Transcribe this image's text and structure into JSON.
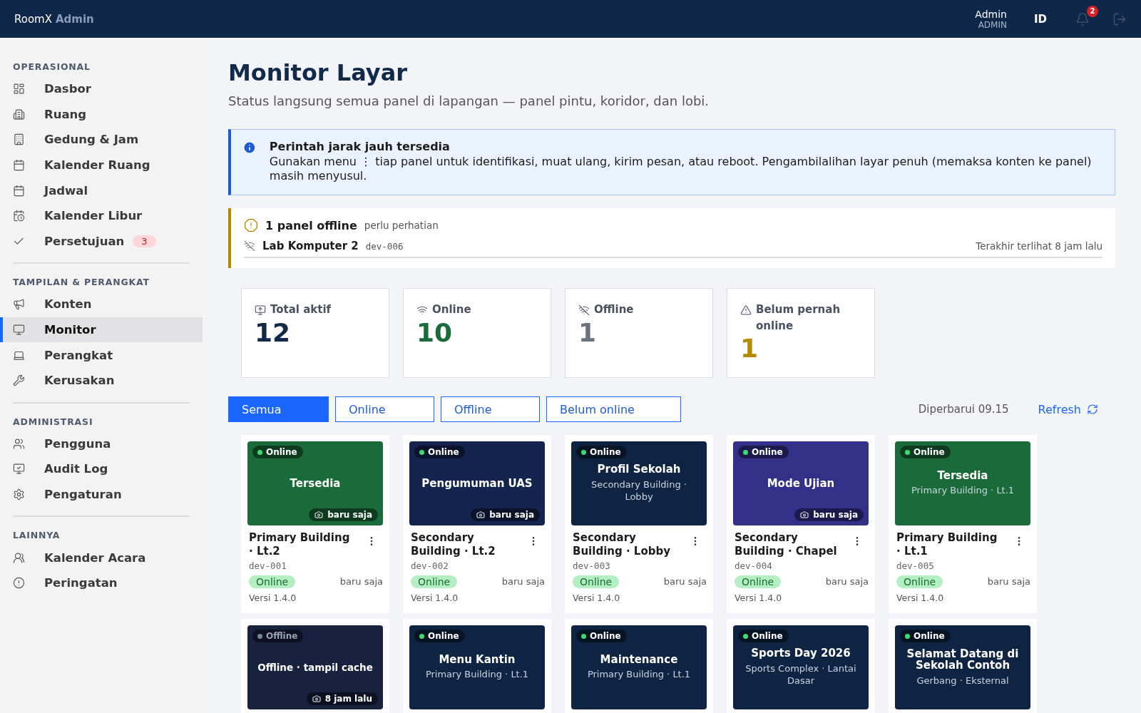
{
  "topbar": {
    "brand": "RoomX",
    "brand_suffix": "Admin",
    "user": {
      "name": "Admin",
      "role": "ADMIN"
    },
    "language": "ID",
    "notifications": "2"
  },
  "sidebar": {
    "sections": [
      {
        "heading": "OPERASIONAL",
        "items": [
          {
            "label": "Dasbor",
            "selected": false
          },
          {
            "label": "Ruang",
            "selected": false
          },
          {
            "label": "Gedung & Jam",
            "selected": false
          },
          {
            "label": "Kalender Ruang",
            "selected": false
          },
          {
            "label": "Jadwal",
            "selected": false
          },
          {
            "label": "Kalender Libur",
            "selected": false
          },
          {
            "label": "Persetujuan",
            "selected": false,
            "badge": "3"
          }
        ]
      },
      {
        "heading": "TAMPILAN & PERANGKAT",
        "items": [
          {
            "label": "Konten",
            "selected": false
          },
          {
            "label": "Monitor",
            "selected": true
          },
          {
            "label": "Perangkat",
            "selected": false
          },
          {
            "label": "Kerusakan",
            "selected": false
          }
        ]
      },
      {
        "heading": "ADMINISTRASI",
        "items": [
          {
            "label": "Pengguna",
            "selected": false
          },
          {
            "label": "Audit Log",
            "selected": false
          },
          {
            "label": "Pengaturan",
            "selected": false
          }
        ]
      },
      {
        "heading": "LAINNYA",
        "items": [
          {
            "label": "Kalender Acara",
            "selected": false
          },
          {
            "label": "Peringatan",
            "selected": false
          }
        ]
      }
    ]
  },
  "page": {
    "title": "Monitor Layar",
    "subtitle": "Status langsung semua panel di lapangan — panel pintu, koridor, dan lobi."
  },
  "info_alert": {
    "title": "Perintah jarak jauh tersedia",
    "text": "Gunakan menu ⋮ tiap panel untuk identifikasi, muat ulang, kirim pesan, atau reboot. Pengambilalihan layar penuh (memaksa konten ke panel) masih menyusul."
  },
  "offline_alert": {
    "title": "1 panel offline",
    "note": "perlu perhatian",
    "panels": [
      {
        "name": "Lab Komputer 2",
        "device": "dev-006",
        "last_seen": "Terakhir terlihat 8 jam lalu"
      }
    ]
  },
  "stats": [
    {
      "label": "Total aktif",
      "value": "12",
      "color": "#112a4a"
    },
    {
      "label": "Online",
      "value": "10",
      "color": "#1b6b3a"
    },
    {
      "label": "Offline",
      "value": "1",
      "color": "#6b7280"
    },
    {
      "label": "Belum pernah online",
      "value": "1",
      "color": "#b58a00"
    }
  ],
  "filters": [
    {
      "label": "Semua",
      "selected": true
    },
    {
      "label": "Online",
      "selected": false
    },
    {
      "label": "Offline",
      "selected": false
    },
    {
      "label": "Belum online",
      "selected": false
    }
  ],
  "updated": "Diperbarui 09.15",
  "refresh": "Refresh",
  "panels": [
    {
      "online": true,
      "badge": "Online",
      "color": "#1b6b3a",
      "title": "Tersedia",
      "snapshot": "baru saja",
      "name": "Primary Building · Lt.2",
      "device": "dev-001",
      "status": "Online",
      "seen": "baru saja",
      "version": "Versi 1.4.0"
    },
    {
      "online": true,
      "badge": "Online",
      "color": "#14244f",
      "title": "Pengumuman UAS",
      "snapshot": "baru saja",
      "name": "Secondary Building · Lt.2",
      "device": "dev-002",
      "status": "Online",
      "seen": "baru saja",
      "version": "Versi 1.4.0"
    },
    {
      "online": true,
      "badge": "Online",
      "color": "#0f2442",
      "title": "Profil Sekolah",
      "subtitle": "Secondary Building · Lobby",
      "name": "Secondary Building · Lobby",
      "device": "dev-003",
      "status": "Online",
      "seen": "baru saja",
      "version": "Versi 1.4.0"
    },
    {
      "online": true,
      "badge": "Online",
      "color": "#33308a",
      "title": "Mode Ujian",
      "snapshot": "baru saja",
      "name": "Secondary Building · Chapel",
      "device": "dev-004",
      "status": "Online",
      "seen": "baru saja",
      "version": "Versi 1.4.0"
    },
    {
      "online": true,
      "badge": "Online",
      "color": "#1b6b3a",
      "title": "Tersedia",
      "subtitle": "Primary Building · Lt.1",
      "name": "Primary Building · Lt.1",
      "device": "dev-005",
      "status": "Online",
      "seen": "baru saja",
      "version": "Versi 1.4.0"
    },
    {
      "online": false,
      "badge": "Offline",
      "color": "#17223f",
      "overlay": "Offline · tampil cache",
      "snapshot": "8 jam lalu"
    },
    {
      "online": true,
      "badge": "Online",
      "color": "#0f2442",
      "title": "Menu Kantin",
      "subtitle": "Primary Building · Lt.1"
    },
    {
      "online": true,
      "badge": "Online",
      "color": "#0f2442",
      "title": "Maintenance",
      "subtitle": "Primary Building · Lt.1"
    },
    {
      "online": true,
      "badge": "Online",
      "color": "#0f2442",
      "title": "Sports Day 2026",
      "subtitle": "Sports Complex · Lantai Dasar"
    },
    {
      "online": true,
      "badge": "Online",
      "color": "#0f2442",
      "title": "Selamat Datang di Sekolah Contoh",
      "subtitle": "Gerbang · Eksternal"
    }
  ]
}
